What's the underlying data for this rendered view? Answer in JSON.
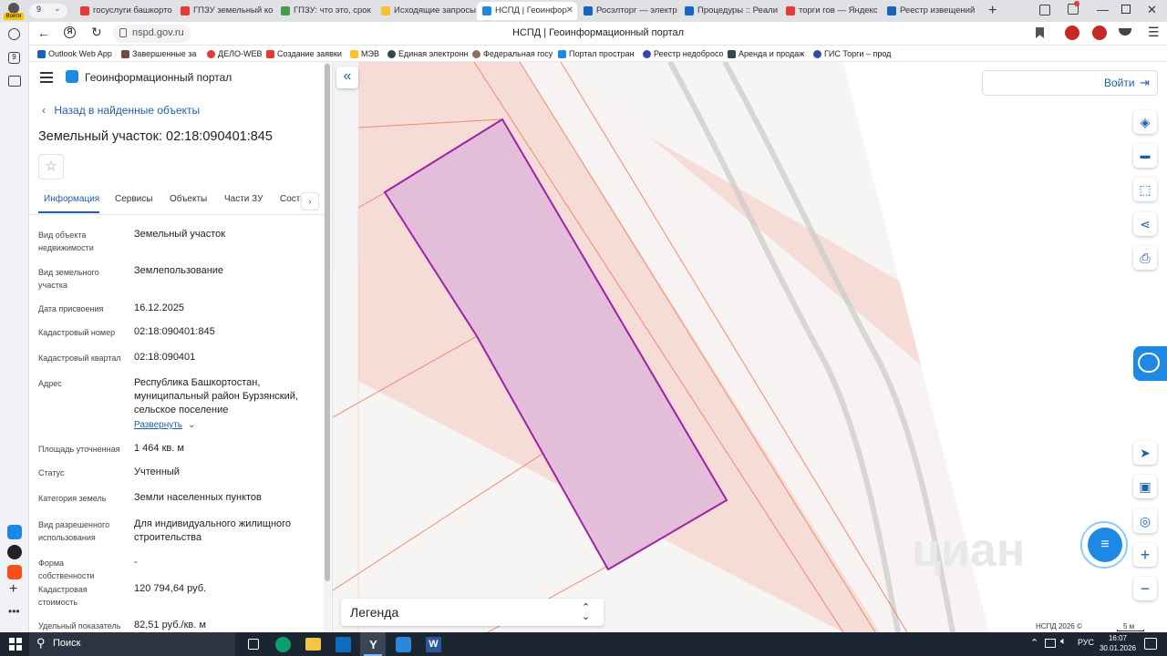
{
  "browser": {
    "tab_count": "9",
    "profile_label": "Войти",
    "tabs": [
      {
        "title": "госуслуги башкорто",
        "color": "#e53935"
      },
      {
        "title": "ГПЗУ земельный ко",
        "color": "#e53935"
      },
      {
        "title": "ГПЗУ: что это, срок",
        "color": "#43a047"
      },
      {
        "title": "Исходящие запросы",
        "color": "#fbc02d"
      },
      {
        "title": "НСПД | Геоинфор",
        "color": "#1e88e5"
      },
      {
        "title": "Росэлторг — электр",
        "color": "#1565c0"
      },
      {
        "title": "Процедуры :: Реали",
        "color": "#1565c0"
      },
      {
        "title": "торги гов — Яндекс",
        "color": "#e53935"
      },
      {
        "title": "Реестр извещений",
        "color": "#1565c0"
      }
    ],
    "url": "nspd.gov.ru",
    "page_title": "НСПД | Геоинформационный портал",
    "bookmarks": [
      {
        "label": "Outlook Web App",
        "color": "#1565c0"
      },
      {
        "label": "Завершенные за",
        "color": "#6d4c41"
      },
      {
        "label": "ДЕЛО-WEB",
        "color": "#e53935"
      },
      {
        "label": "Создание заявки",
        "color": "#e53935"
      },
      {
        "label": "МЭВ",
        "color": "#fbc02d"
      },
      {
        "label": "Единая электронн",
        "color": "#37474f"
      },
      {
        "label": "Федеральная госу",
        "color": "#8d6e63"
      },
      {
        "label": "Портал простран",
        "color": "#1e88e5"
      },
      {
        "label": "Реестр недобросо",
        "color": "#3949ab"
      },
      {
        "label": "Аренда и продаж",
        "color": "#37474f"
      },
      {
        "label": "ГИС Торги – прод",
        "color": "#3949ab"
      }
    ]
  },
  "portal": {
    "title": "Геоинформационный портал",
    "back_link": "Назад в найденные объекты",
    "object_title": "Земельный участок: 02:18:090401:845",
    "tabs": [
      "Информация",
      "Сервисы",
      "Объекты",
      "Части ЗУ",
      "Соста"
    ],
    "fields": [
      {
        "label": "Вид объекта недвижимости",
        "value": "Земельный участок"
      },
      {
        "label": "Вид земельного участка",
        "value": "Землепользование"
      },
      {
        "label": "Дата присвоения",
        "value": "16.12.2025"
      },
      {
        "label": "Кадастровый номер",
        "value": "02:18:090401:845"
      },
      {
        "label": "Кадастровый квартал",
        "value": "02:18:090401"
      },
      {
        "label": "Адрес",
        "value": "Республика Башкортостан, муниципальный район Бурзянский, сельское поселение"
      },
      {
        "label": "Площадь уточненная",
        "value": "1 464 кв. м"
      },
      {
        "label": "Статус",
        "value": "Учтенный"
      },
      {
        "label": "Категория земель",
        "value": "Земли населенных пунктов"
      },
      {
        "label": "Вид разрешенного использования",
        "value": "Для индивидуального жилищного строительства"
      },
      {
        "label": "Форма собственности",
        "value": "-"
      },
      {
        "label": "Кадастровая стоимость",
        "value": "120 794,64 руб."
      },
      {
        "label": "Удельный показатель",
        "value": "82,51 руб./кв. м"
      }
    ],
    "expand_link": "Развернуть",
    "login_label": "Войти",
    "legend_label": "Легенда",
    "copyright": "НСПД 2026 ©",
    "scale_label": "5 м",
    "watermark": "циан"
  },
  "taskbar": {
    "search_label": "Поиск",
    "language": "РУС",
    "time": "16:07",
    "date": "30.01.2026"
  },
  "colors": {
    "parcel_fill": "#e2bcd9",
    "parcel_stroke": "#a020a8",
    "boundary": "#f08a6c",
    "zone_fill": "#f5dcd6",
    "accent": "#1e5fa8",
    "taskbar": "#1c2633"
  }
}
